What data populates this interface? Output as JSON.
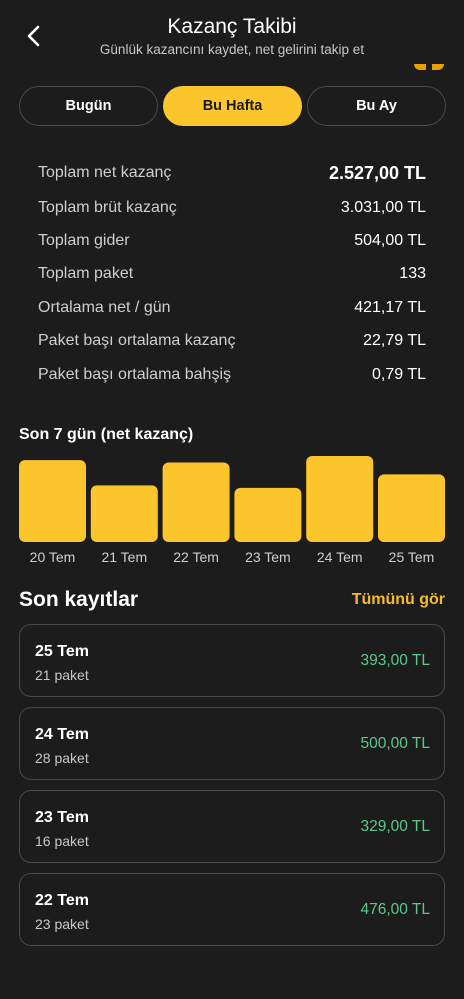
{
  "header": {
    "title": "Kazanç Takibi",
    "subtitle": "Günlük kazancını kaydet, net gelirini takip et",
    "back_icon": "chevron-left-icon"
  },
  "tabs": [
    {
      "label": "Bugün",
      "selected": false
    },
    {
      "label": "Bu Hafta",
      "selected": true
    },
    {
      "label": "Bu Ay",
      "selected": false
    }
  ],
  "stats": [
    {
      "label": "Toplam net kazanç",
      "value": "2.527,00 TL"
    },
    {
      "label": "Toplam brüt kazanç",
      "value": "3.031,00 TL"
    },
    {
      "label": "Toplam gider",
      "value": "504,00 TL"
    },
    {
      "label": "Toplam paket",
      "value": "133"
    },
    {
      "label": "Ortalama net / gün",
      "value": "421,17 TL"
    },
    {
      "label": "Paket başı ortalama kazanç",
      "value": "22,79 TL"
    },
    {
      "label": "Paket başı ortalama bahşiş",
      "value": "0,79 TL"
    }
  ],
  "chart_title": "Son 7 gün (net kazanç)",
  "chart_data": {
    "type": "bar",
    "categories": [
      "20 Tem",
      "21 Tem",
      "22 Tem",
      "23 Tem",
      "24 Tem",
      "25 Tem"
    ],
    "values": [
      476,
      329,
      462,
      315,
      500,
      393
    ],
    "ylim": [
      0,
      500
    ],
    "bar_color": "#fcc52b",
    "grid": false
  },
  "recent": {
    "title": "Son kayıtlar",
    "see_all": "Tümünü gör",
    "items": [
      {
        "date": "25 Tem",
        "packages": "21 paket",
        "amount": "393,00 TL"
      },
      {
        "date": "24 Tem",
        "packages": "28 paket",
        "amount": "500,00 TL"
      },
      {
        "date": "23 Tem",
        "packages": "16 paket",
        "amount": "329,00 TL"
      },
      {
        "date": "22 Tem",
        "packages": "23 paket",
        "amount": "476,00 TL"
      }
    ]
  },
  "colors": {
    "background": "#1c1c1c",
    "accent": "#fcc52b",
    "positive": "#5cc98c",
    "border": "#4a4a4a"
  }
}
